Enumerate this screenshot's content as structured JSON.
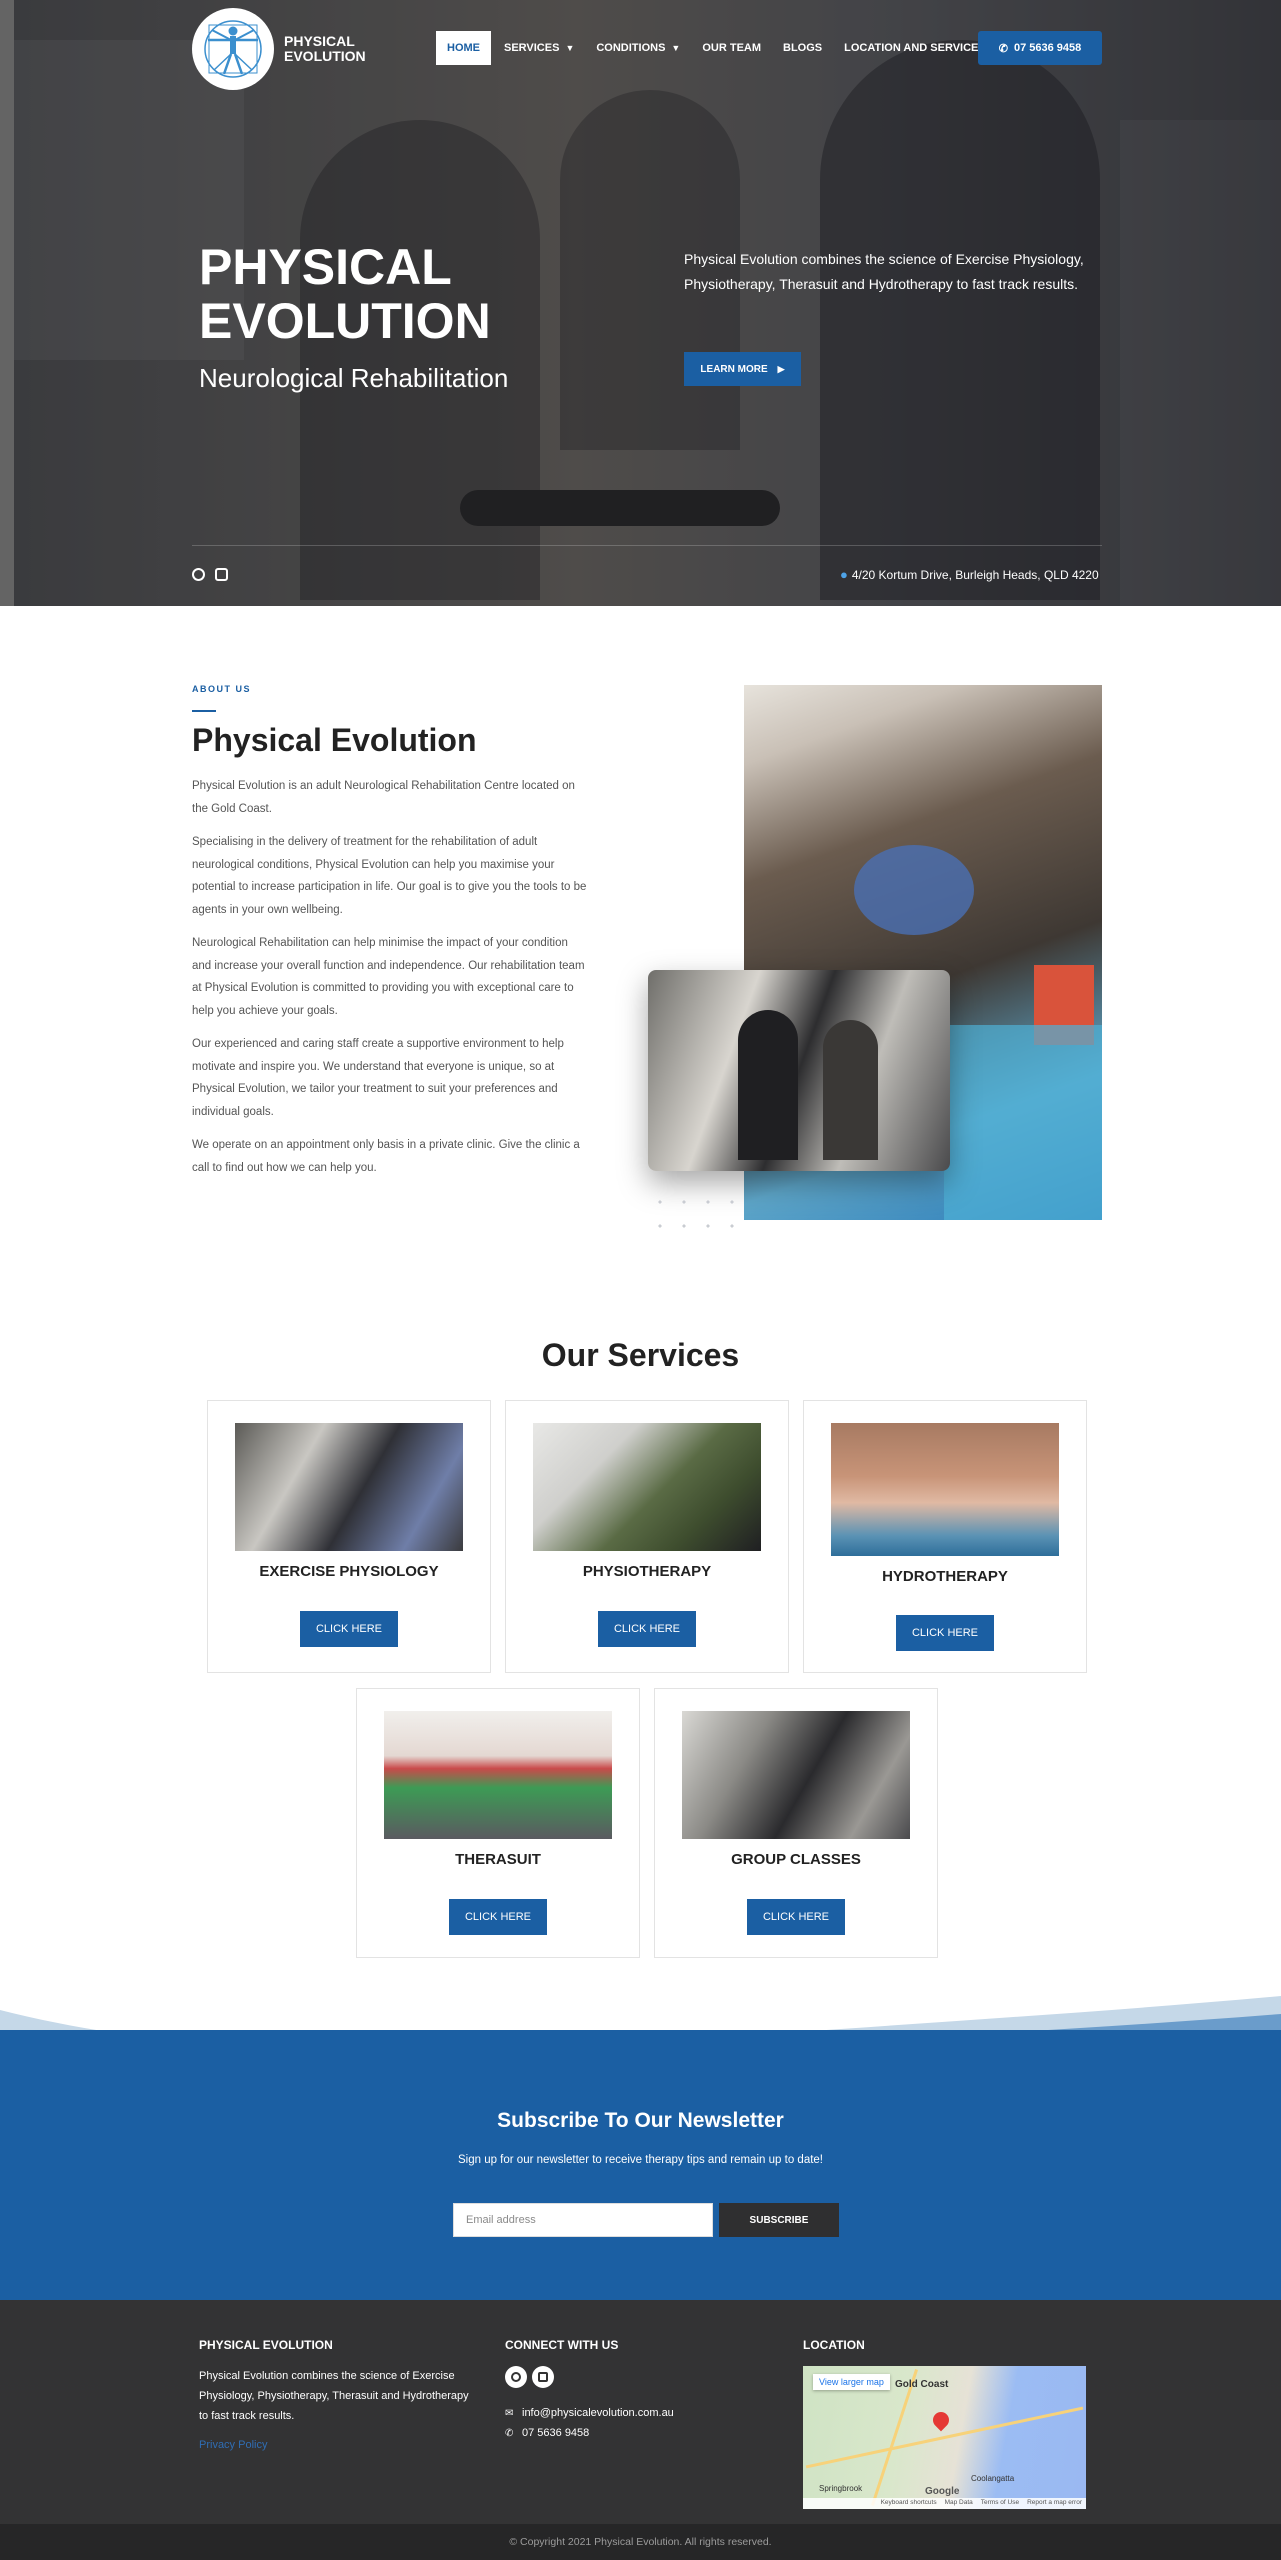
{
  "brand": {
    "name_line1": "PHYSICAL",
    "name_line2": "EVOLUTION"
  },
  "nav": {
    "items": [
      {
        "label": "HOME"
      },
      {
        "label": "SERVICES"
      },
      {
        "label": "CONDITIONS"
      },
      {
        "label": "OUR TEAM"
      },
      {
        "label": "BLOGS"
      },
      {
        "label": "LOCATION AND SERVICES"
      }
    ],
    "phone": "07 5636 9458"
  },
  "hero": {
    "title_line1": "PHYSICAL",
    "title_line2": "EVOLUTION",
    "subtitle": "Neurological Rehabilitation",
    "text": "Physical Evolution combines the science of Exercise Physiology, Physiotherapy, Therasuit and Hydrotherapy to fast track results.",
    "button": "LEARN MORE",
    "address": "4/20 Kortum Drive, Burleigh Heads, QLD 4220"
  },
  "about": {
    "label": "ABOUT US",
    "title": "Physical Evolution",
    "paragraphs": [
      "Physical Evolution is an adult Neurological Rehabilitation Centre located on the Gold Coast.",
      "Specialising in the delivery of treatment for the rehabilitation of adult neurological conditions, Physical Evolution can help you maximise your potential to increase participation in life. Our goal is to give you the tools to be agents in your own wellbeing.",
      "Neurological Rehabilitation can help minimise the impact of your condition and increase your overall function and independence. Our rehabilitation team at Physical Evolution is committed to providing you with exceptional care to help you achieve your goals.",
      "Our experienced and caring staff create a supportive environment to help motivate and inspire you. We understand that everyone is unique, so at Physical Evolution, we tailor your treatment to suit your preferences and individual goals.",
      "We operate on an appointment only basis in a private clinic. Give the clinic a call to find out how we can help you."
    ]
  },
  "services": {
    "title": "Our Services",
    "items": [
      {
        "name": "EXERCISE PHYSIOLOGY",
        "button": "CLICK HERE"
      },
      {
        "name": "PHYSIOTHERAPY",
        "button": "CLICK HERE"
      },
      {
        "name": "HYDROTHERAPY",
        "button": "CLICK HERE"
      },
      {
        "name": "THERASUIT",
        "button": "CLICK HERE"
      },
      {
        "name": "GROUP CLASSES",
        "button": "CLICK HERE"
      }
    ]
  },
  "newsletter": {
    "title": "Subscribe To Our Newsletter",
    "subtitle": "Sign up for our newsletter to receive therapy tips and remain up to date!",
    "placeholder": "Email address",
    "button": "SUBSCRIBE"
  },
  "footer": {
    "col1_title": "PHYSICAL EVOLUTION",
    "col1_text": "Physical Evolution combines the science of Exercise Physiology, Physiotherapy, Therasuit and Hydrotherapy to fast track results.",
    "privacy": "Privacy Policy",
    "col2_title": "CONNECT WITH US",
    "email": "info@physicalevolution.com.au",
    "phone": "07 5636 9458",
    "col3_title": "LOCATION",
    "map": {
      "larger_link": "View larger map",
      "label_gold_coast": "Gold Coast",
      "label_coolangatta": "Coolangatta",
      "label_springbrook": "Springbrook",
      "bar_shortcuts": "Keyboard shortcuts",
      "bar_data": "Map Data",
      "bar_terms": "Terms of Use",
      "bar_report": "Report a map error",
      "google": "Google"
    },
    "copyright": "© Copyright 2021 Physical Evolution. All rights reserved."
  },
  "colors": {
    "primary": "#1b5fa3",
    "dark": "#333334",
    "accent_pin": "#4ea3e8"
  },
  "icons": [
    "phone-icon",
    "caret-down-icon",
    "arrow-right-icon",
    "facebook-icon",
    "instagram-icon",
    "location-pin-icon",
    "email-icon",
    "map-marker-icon"
  ]
}
